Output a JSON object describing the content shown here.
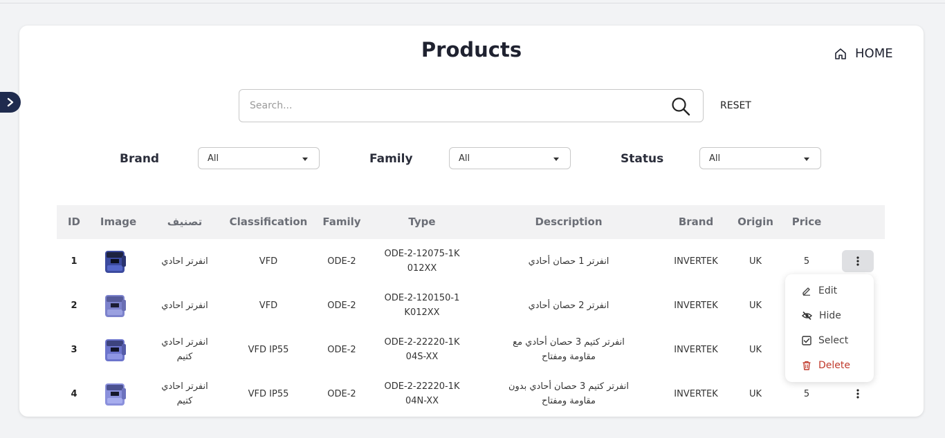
{
  "header": {
    "title": "Products",
    "home_label": "HOME"
  },
  "search": {
    "placeholder": "Search...",
    "value": "",
    "reset_label": "RESET"
  },
  "filters": [
    {
      "label": "Brand",
      "value": "All"
    },
    {
      "label": "Family",
      "value": "All"
    },
    {
      "label": "Status",
      "value": "All"
    }
  ],
  "table": {
    "columns": [
      "ID",
      "Image",
      "تصنيف",
      "Classification",
      "Family",
      "Type",
      "Description",
      "Brand",
      "Origin",
      "Price"
    ],
    "rows": [
      {
        "id": "1",
        "image": "inverter-image",
        "tasnif": "انفرتر احادي",
        "classification": "VFD",
        "family": "ODE-2",
        "type": "ODE-2-12075-1K012XX",
        "description": "انفرتر 1  حصان أحادي",
        "brand": "INVERTEK",
        "origin": "UK",
        "price": "5"
      },
      {
        "id": "2",
        "image": "inverter-image",
        "tasnif": "انفرتر احادي",
        "classification": "VFD",
        "family": "ODE-2",
        "type": "ODE-2-120150-1K012XX",
        "description": "انفرتر 2  حصان أحادي",
        "brand": "INVERTEK",
        "origin": "UK",
        "price": ""
      },
      {
        "id": "3",
        "image": "inverter-image",
        "tasnif": "انفرتر احادي كتيم",
        "classification": "VFD IP55",
        "family": "ODE-2",
        "type": "ODE-2-22220-1K04S-XX",
        "description": "انفرتر كتيم 3 حصان أحادي مع مقاومة ومفتاح",
        "brand": "INVERTEK",
        "origin": "UK",
        "price": ""
      },
      {
        "id": "4",
        "image": "inverter-image",
        "tasnif": "انفرتر احادي كتيم",
        "classification": "VFD IP55",
        "family": "ODE-2",
        "type": "ODE-2-22220-1K04N-XX",
        "description": "انفرتر كتيم 3 حصان أحادي بدون مقاومة ومفتاح",
        "brand": "INVERTEK",
        "origin": "UK",
        "price": "5"
      }
    ]
  },
  "row_menu": {
    "edit": "Edit",
    "hide": "Hide",
    "select": "Select",
    "delete": "Delete"
  },
  "colors": {
    "accent": "#1f2b4e",
    "danger": "#c0392b"
  },
  "icons": [
    "chevron-right-icon",
    "home-icon",
    "search-icon",
    "kebab-icon",
    "edit-icon",
    "eye-slash-icon",
    "checkbox-icon",
    "trash-icon"
  ]
}
